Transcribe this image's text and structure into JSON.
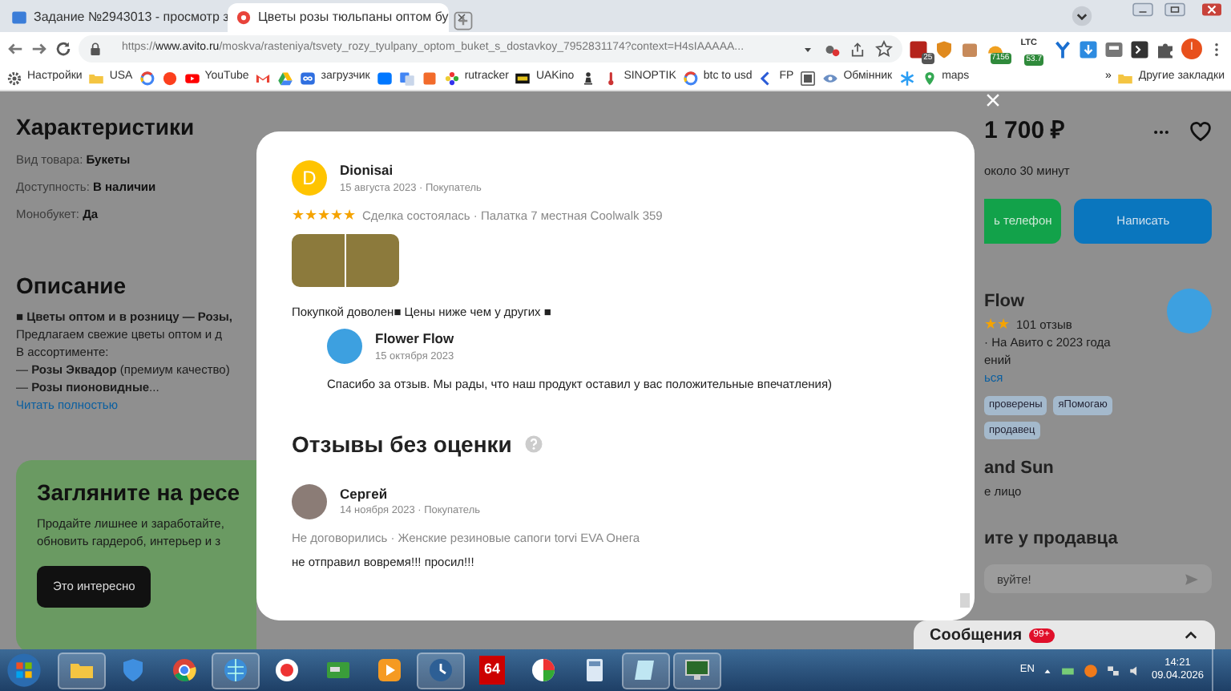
{
  "browser": {
    "tabs": [
      {
        "label": "Задание №2943013 - просмотр з",
        "kind": "sp",
        "selected": false
      },
      {
        "label": "Цветы розы тюльпаны оптом бу",
        "kind": "avito",
        "selected": true
      }
    ],
    "url": {
      "scheme": "https://",
      "host": "www.avito.ru",
      "path": "/moskva/rasteniya/tsvety_rozy_tyulpany_optom_buket_s_dostavkoy_7952831174?context=H4sIAAAAA..."
    },
    "extensions": [
      {
        "kind": "red",
        "badge": "25"
      },
      {
        "kind": "shield"
      },
      {
        "kind": "box"
      },
      {
        "kind": "gauge",
        "badge": "7156"
      },
      {
        "kind": "ltc",
        "label": "LTC",
        "badge": "53.7"
      },
      {
        "kind": "fork"
      },
      {
        "kind": "download"
      },
      {
        "kind": "tray"
      },
      {
        "kind": "terminal"
      },
      {
        "kind": "puzzle"
      }
    ],
    "profile_initial": "I",
    "bookmarks": [
      {
        "kind": "gear",
        "label": "Настройки"
      },
      {
        "kind": "folder",
        "label": "USA"
      },
      {
        "kind": "ring"
      },
      {
        "kind": "ya"
      },
      {
        "kind": "youtube",
        "label": "YouTube"
      },
      {
        "kind": "gmail"
      },
      {
        "kind": "drive"
      },
      {
        "kind": "loader",
        "label": "загрузчик"
      },
      {
        "kind": "vk"
      },
      {
        "kind": "translate"
      },
      {
        "kind": "f"
      },
      {
        "kind": "flower",
        "label": "rutracker"
      },
      {
        "kind": "film",
        "label": "UAKino"
      },
      {
        "kind": "chess"
      },
      {
        "kind": "thermo",
        "label": "SINOPTIK"
      },
      {
        "kind": "ring",
        "label": "btc to usd"
      },
      {
        "kind": "chevron",
        "label": "FP"
      },
      {
        "kind": "tile"
      },
      {
        "kind": "eye",
        "label": "Обмінник"
      },
      {
        "kind": "asterisk"
      },
      {
        "kind": "pin",
        "label": "maps"
      }
    ],
    "bookmarks_more": "»",
    "other_bookmarks": "Другие закладки"
  },
  "page": {
    "specs_title": "Характеристики",
    "specs": [
      "Вид товара: **Букеты**",
      "Доступность: **В наличии**",
      "Монобукет: **Да**"
    ],
    "description_title": "Описание",
    "description": [
      "■ **Цветы оптом и в розницу — Розы,**",
      "Предлагаем свежие цветы оптом и д",
      "В ассортименте:",
      "— **Розы Эквадор** (премиум качество)",
      "— **Розы пионовидные**..."
    ],
    "read_more": "Читать полностью",
    "banner": {
      "title": "Загляните на ресе",
      "lines": [
        "Продайте лишнее и заработайте,",
        "обновить гардероб, интерьер и з"
      ],
      "button": "Это интересно"
    },
    "price": "1 700 ₽",
    "reply_time": "около 30 минут",
    "phone_button": "ь телефон",
    "write_button": "Написать",
    "seller": {
      "name": "Flow",
      "star_marks": "★★",
      "reviews": "101 отзыв",
      "since": "· На Авито с 2023 года",
      "line_3": "ений",
      "link": "ься",
      "tags": [
        "проверены",
        "яПомогаю",
        "продавец"
      ]
    },
    "company": {
      "name": "and Sun",
      "type": "е лицо"
    },
    "ask_title": "ите у продавца",
    "message_placeholder": "вуйте!",
    "messages": {
      "label": "Сообщения",
      "badge": "99+"
    }
  },
  "modal": {
    "reviews": [
      {
        "author": "Dionisai",
        "avatar": {
          "kind": "letter",
          "letter": "D"
        },
        "meta": "15 августа 2023 · Покупатель",
        "stars": 5,
        "deal": "Сделка состоялась · Палатка 7 местная Coolwalk 359",
        "photos": [
          {
            "kind": "photo"
          },
          {
            "kind": "photo"
          }
        ],
        "text": "Покупкой доволен■ Цены ниже чем у других ■",
        "reply": {
          "author": "Flower Flow",
          "meta": "15 октября 2023",
          "text": "Спасибо за отзыв. Мы рады, что наш продукт оставил у вас положительные впечатления)"
        }
      }
    ],
    "unrated_title": "Отзывы без оценки",
    "unrated": [
      {
        "author": "Сергей",
        "avatar": {
          "kind": "photo"
        },
        "meta": "14 ноября 2023 · Покупатель",
        "deal": "Не договорились · Женские резиновые сапоги torvi EVA Онега",
        "text": "не отправил вовремя!!! просил!!!"
      }
    ]
  },
  "taskbar": {
    "apps": [
      {
        "kind": "folder",
        "running": true
      },
      {
        "kind": "shield",
        "running": false
      },
      {
        "kind": "chrome",
        "running": false
      },
      {
        "kind": "globe",
        "running": true
      },
      {
        "kind": "yandex",
        "running": false
      },
      {
        "kind": "card",
        "running": false
      },
      {
        "kind": "player",
        "running": false
      },
      {
        "kind": "clock",
        "running": true
      },
      {
        "kind": "tile",
        "text": "64",
        "running": false
      },
      {
        "kind": "pie",
        "running": false
      },
      {
        "kind": "calculator",
        "running": false
      },
      {
        "kind": "notepad",
        "running": true
      },
      {
        "kind": "monitor",
        "running": true
      }
    ],
    "language": "EN",
    "time": "14:21",
    "date": "09.04.2026"
  }
}
